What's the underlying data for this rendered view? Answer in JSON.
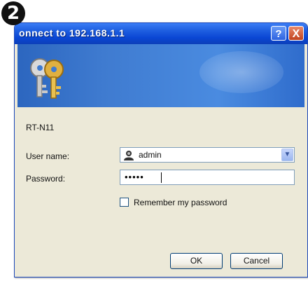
{
  "step_number": "2",
  "window": {
    "title": "onnect to 192.168.1.1",
    "help_button": "?",
    "close_button": "X"
  },
  "server_name": "RT-N11",
  "fields": {
    "user_name_label": "User name:",
    "user_name_value": "admin",
    "password_label": "Password:",
    "password_value": "•••••"
  },
  "remember_label": "Remember my password",
  "remember_checked": false,
  "buttons": {
    "ok": "OK",
    "cancel": "Cancel"
  },
  "colors": {
    "titlebar": "#0a46d4",
    "banner": "#3f7bd0",
    "dialog_bg": "#ece9d8",
    "key_gold": "#e0b040"
  },
  "icons": {
    "banner": "keys-icon",
    "user": "user-icon",
    "dropdown": "chevron-down-icon"
  }
}
